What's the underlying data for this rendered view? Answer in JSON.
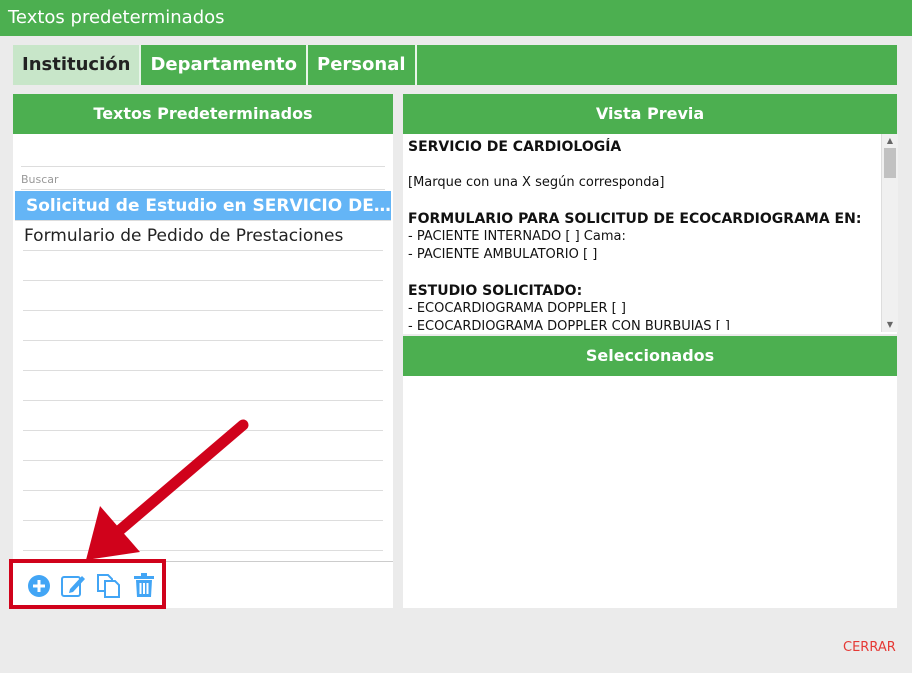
{
  "window": {
    "title": "Textos predeterminados"
  },
  "tabs": [
    {
      "label": "Institución",
      "active": true
    },
    {
      "label": "Departamento",
      "active": false
    },
    {
      "label": "Personal",
      "active": false
    }
  ],
  "left_panel": {
    "title": "Textos Predeterminados",
    "search_placeholder": "Buscar",
    "items": [
      {
        "label": "Solicitud de Estudio en SERVICIO DE CARDIOLOGÍA",
        "selected": true
      },
      {
        "label": "Formulario de Pedido de Prestaciones",
        "selected": false
      }
    ],
    "toolbar_icons": [
      "add-circle-icon",
      "edit-icon",
      "copy-icon",
      "trash-icon"
    ]
  },
  "preview": {
    "title": "Vista Previa",
    "lines": [
      {
        "text": "SERVICIO DE CARDIOLOGÍA",
        "bold": true
      },
      {
        "text": "",
        "bold": false
      },
      {
        "text": "[Marque con una X según corresponda]",
        "bold": false
      },
      {
        "text": "",
        "bold": false
      },
      {
        "text": "FORMULARIO PARA SOLICITUD DE ECOCARDIOGRAMA EN:",
        "bold": true
      },
      {
        "text": "- PACIENTE INTERNADO [ ] Cama:",
        "bold": false
      },
      {
        "text": "- PACIENTE AMBULATORIO [ ]",
        "bold": false
      },
      {
        "text": "",
        "bold": false
      },
      {
        "text": "ESTUDIO SOLICITADO:",
        "bold": true
      },
      {
        "text": "- ECOCARDIOGRAMA DOPPLER [ ]",
        "bold": false
      },
      {
        "text": "- ECOCARDIOGRAMA DOPPLER CON BURBUJAS [ ]",
        "bold": false
      }
    ]
  },
  "selected_panel": {
    "title": "Seleccionados"
  },
  "footer": {
    "close_label": "CERRAR"
  },
  "colors": {
    "green": "#4caf50",
    "selection_blue": "#64b5f6",
    "icon_blue": "#42a5f5",
    "annotation_red": "#d0021b",
    "close_red": "#e53935"
  }
}
